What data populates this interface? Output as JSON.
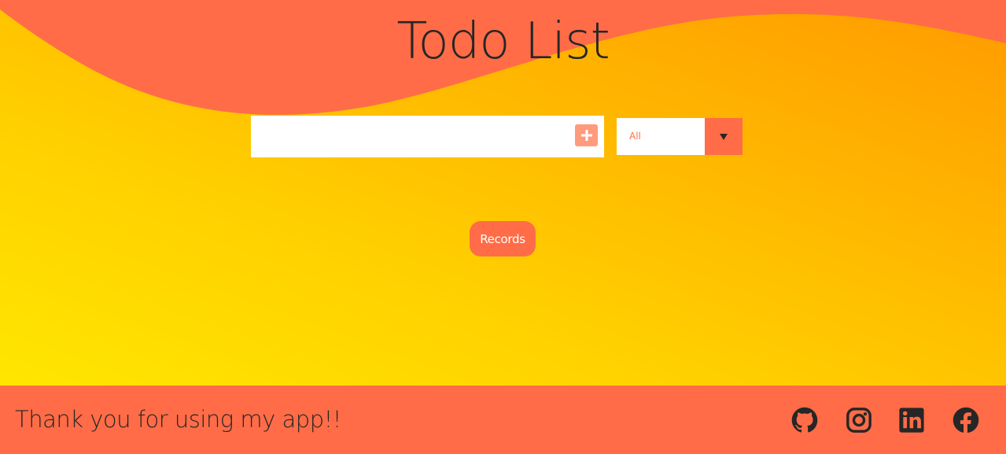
{
  "app": {
    "title": "Todo List"
  },
  "todo_form": {
    "input_value": "",
    "input_placeholder": "",
    "add_icon": "plus-icon"
  },
  "filter": {
    "selected": "All",
    "arrow_icon": "triangle-down-icon"
  },
  "records_button": {
    "label": "Records"
  },
  "footer": {
    "message": "Thank you for using my app!!",
    "social_icons": [
      "github-icon",
      "instagram-icon",
      "linkedin-icon",
      "facebook-icon"
    ]
  },
  "colors": {
    "accent": "#ff6c47",
    "add_button": "#ff9a7d",
    "gradient_start": "#ff9a00",
    "gradient_end": "#ffe600",
    "text_dark": "#262626"
  }
}
